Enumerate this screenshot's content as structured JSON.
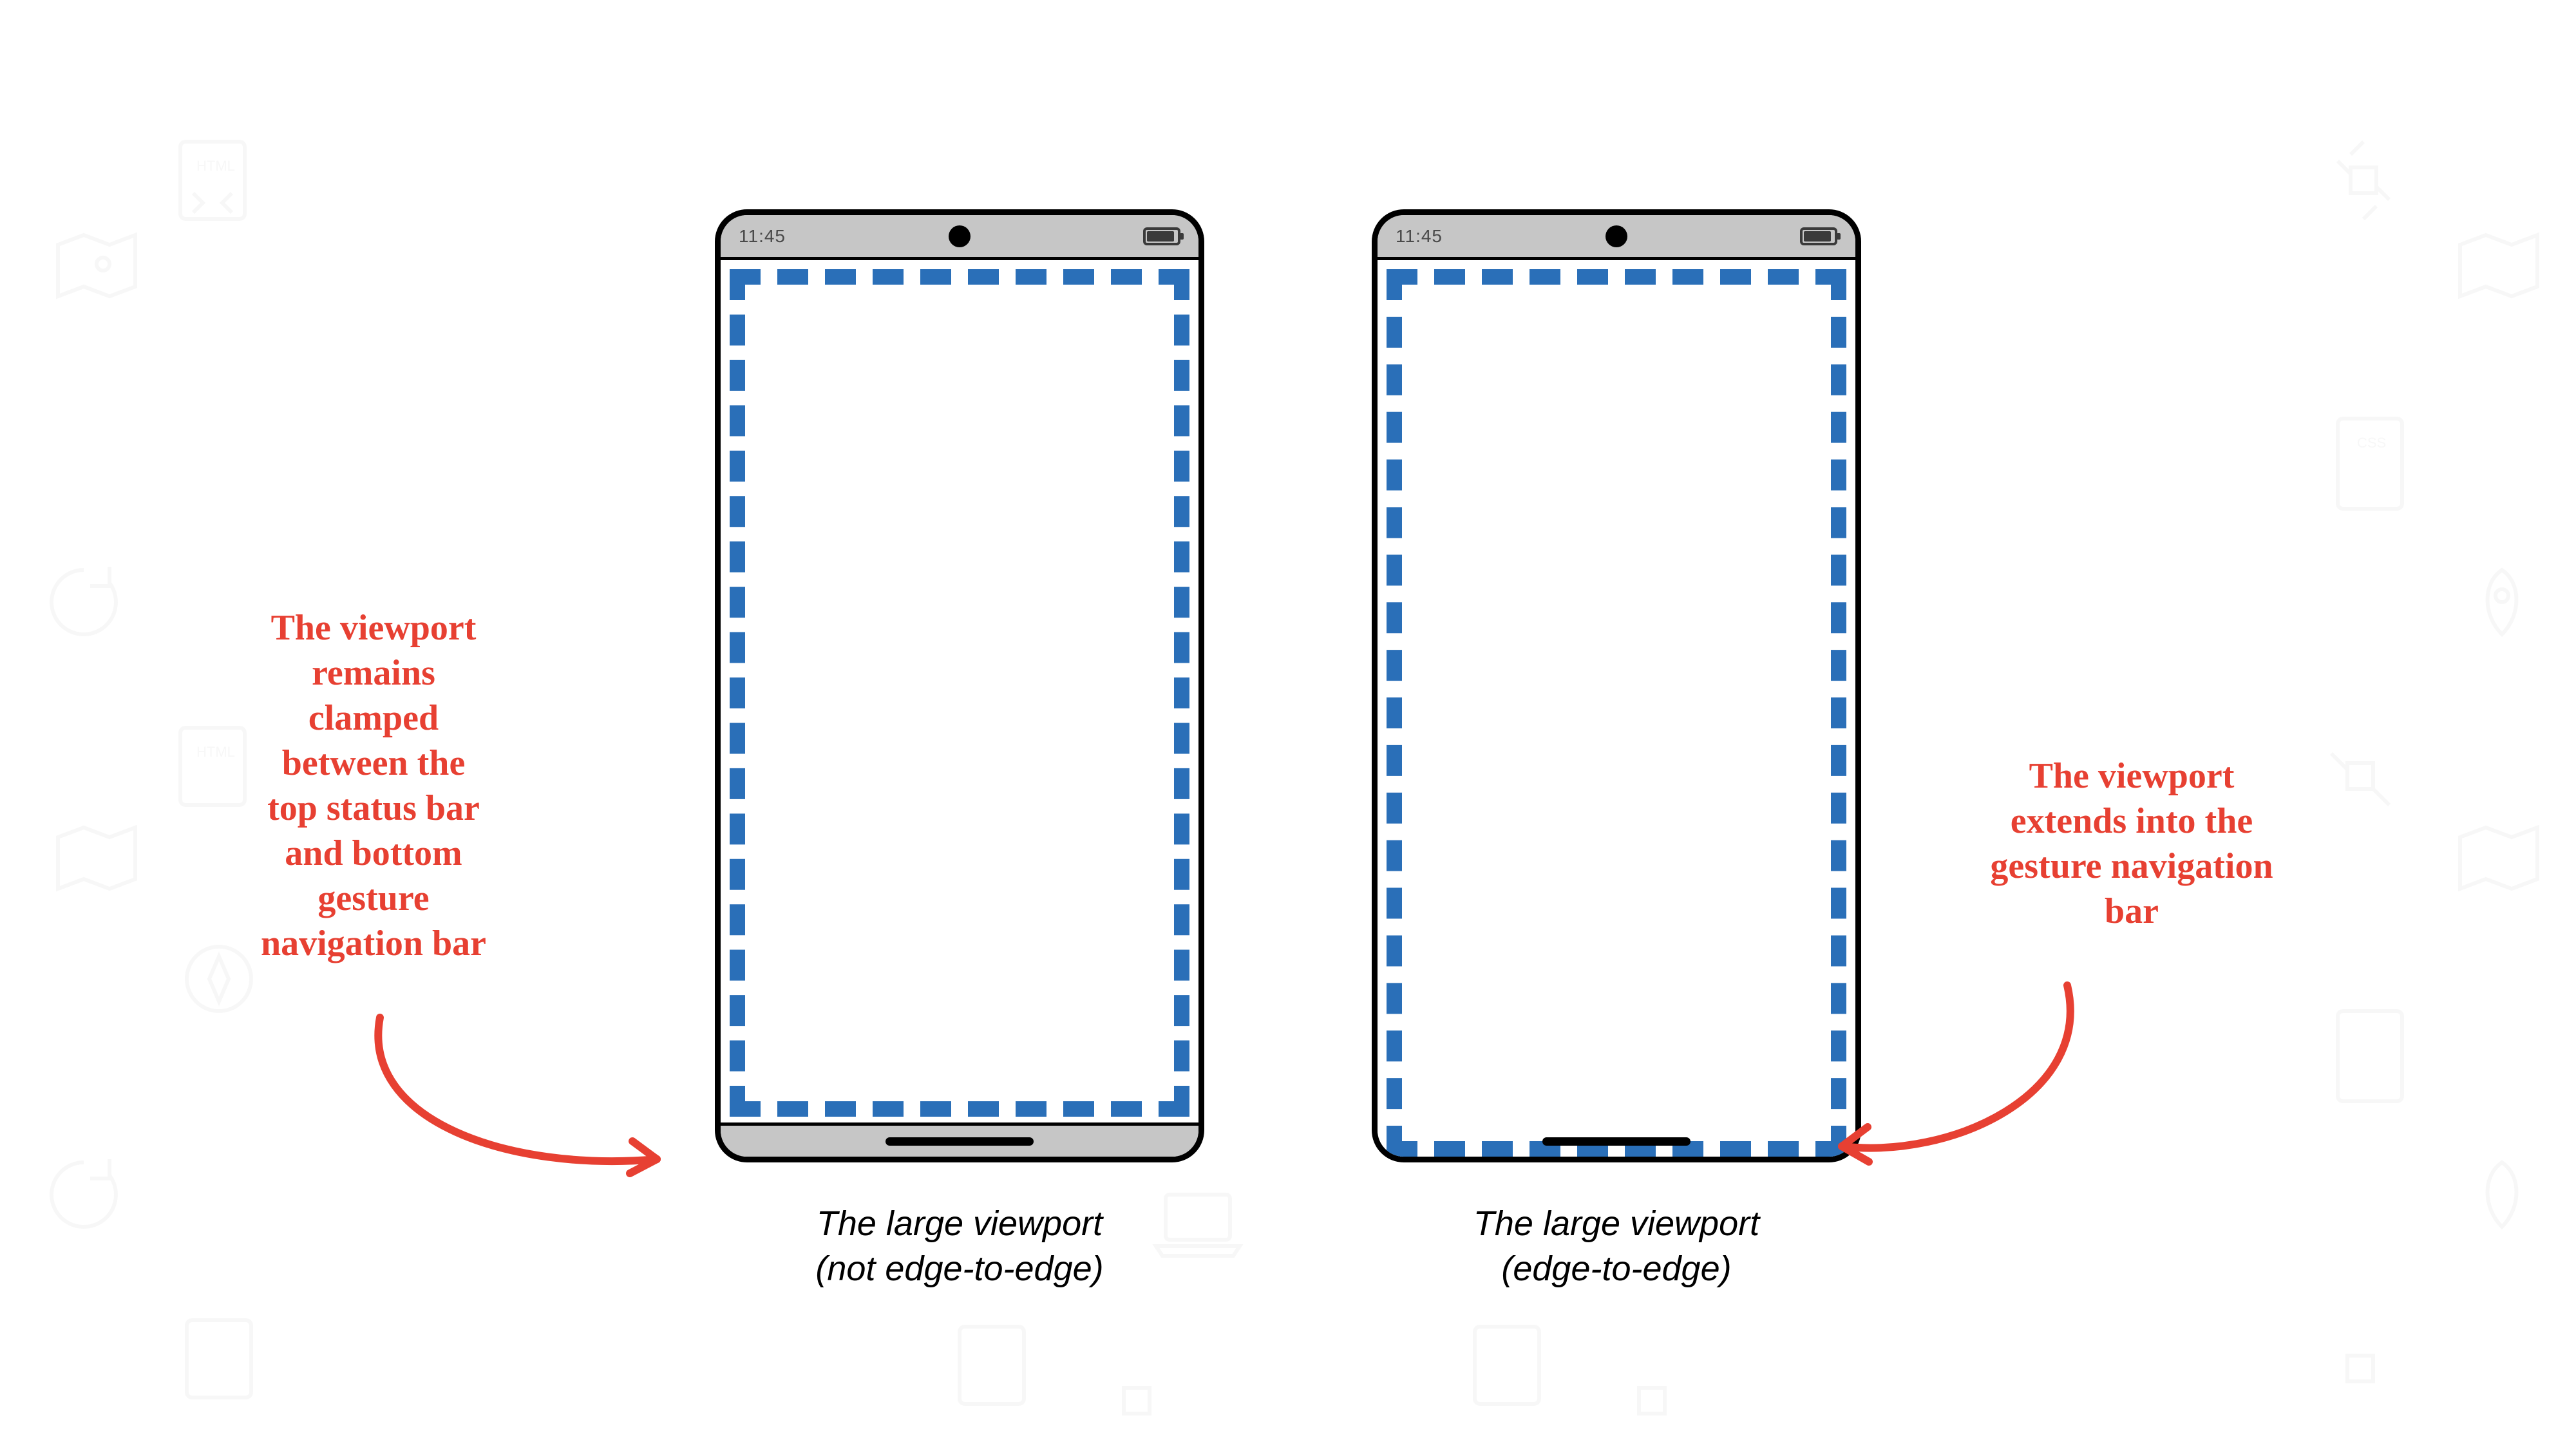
{
  "status_time": "11:45",
  "phones": {
    "left": {
      "caption_line1": "The large viewport",
      "caption_line2": "(not edge-to-edge)"
    },
    "right": {
      "caption_line1": "The large viewport",
      "caption_line2": "(edge-to-edge)"
    }
  },
  "annotations": {
    "left": "The viewport\nremains\nclamped\nbetween the\ntop status bar\nand bottom\ngesture\nnavigation bar",
    "right": "The viewport\nextends into the\ngesture navigation\nbar"
  },
  "colors": {
    "annotation": "#e74032",
    "dashed_border": "#2a6fb8",
    "phone_chrome": "#c6c6c6"
  }
}
